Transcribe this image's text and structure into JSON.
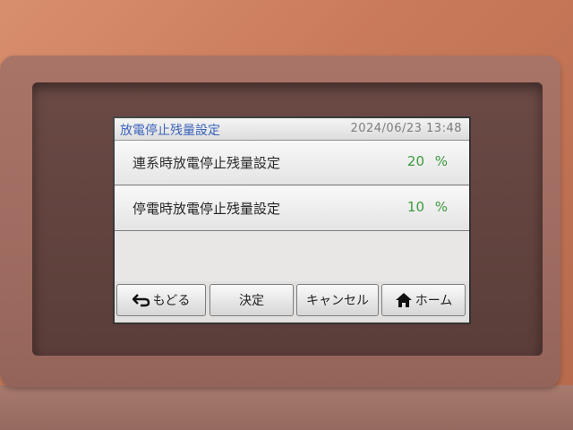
{
  "screen": {
    "title": "放電停止残量設定",
    "datetime": "2024/06/23 13:48"
  },
  "settings": [
    {
      "label": "連系時放電停止残量設定",
      "value": "20",
      "unit": "%"
    },
    {
      "label": "停電時放電停止残量設定",
      "value": "10",
      "unit": "%"
    }
  ],
  "buttons": {
    "back": {
      "label": "もどる",
      "icon": "return-arrow-icon"
    },
    "confirm": {
      "label": "決定"
    },
    "cancel": {
      "label": "キャンセル"
    },
    "home": {
      "label": "ホーム",
      "icon": "house-icon"
    }
  },
  "colors": {
    "title": "#2a56b5",
    "value": "#3d9a3d",
    "datetime": "#7b7b7b"
  }
}
